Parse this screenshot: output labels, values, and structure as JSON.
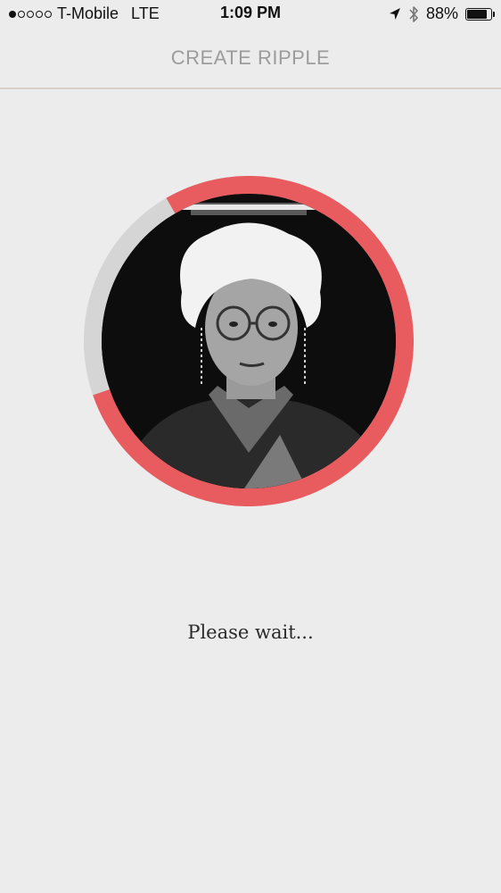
{
  "status_bar": {
    "carrier": "T-Mobile",
    "network": "LTE",
    "time": "1:09 PM",
    "battery_percent_text": "88%",
    "battery_level": 0.88,
    "signal_bars_filled": 1,
    "signal_bars_total": 5
  },
  "header": {
    "title": "CREATE RIPPLE"
  },
  "progress": {
    "fraction": 0.78,
    "progress_color": "#e85c60",
    "track_color": "#d5d5d5"
  },
  "message": {
    "text": "Please wait..."
  }
}
